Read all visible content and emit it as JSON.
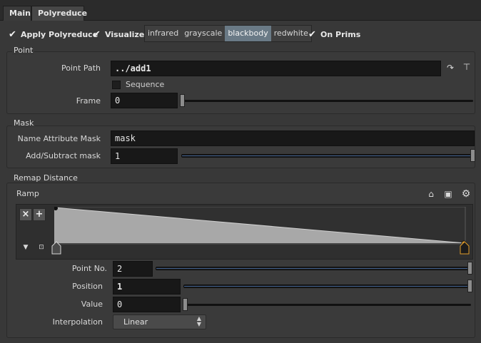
{
  "tabs": {
    "main": "Main",
    "polyreduce": "Polyreduce"
  },
  "options": {
    "apply_polyreduce": {
      "label": "Apply Polyreduce",
      "checked": true
    },
    "visualize": {
      "label": "Visualize",
      "checked": true
    },
    "on_prims": {
      "label": "On Prims",
      "checked": true
    },
    "color_schemes": [
      "infrared",
      "grayscale",
      "blackbody",
      "redwhite"
    ],
    "selected_scheme": "blackbody"
  },
  "point": {
    "title": "Point",
    "path_label": "Point Path",
    "path_value": "../add1",
    "sequence_label": "Sequence",
    "sequence_checked": false,
    "frame_label": "Frame",
    "frame_value": "0",
    "frame_level": 0.0
  },
  "mask": {
    "title": "Mask",
    "name_label": "Name Attribute Mask",
    "name_value": "mask",
    "addsub_label": "Add/Subtract mask",
    "addsub_value": "1",
    "addsub_level": 1.0
  },
  "remap": {
    "title": "Remap Distance",
    "ramp_label": "Ramp",
    "ramp": {
      "type": "linear",
      "keys": [
        {
          "position": 0,
          "value": 1
        },
        {
          "position": 1,
          "value": 0
        }
      ]
    },
    "point_no_label": "Point No.",
    "point_no_value": "2",
    "position_label": "Position",
    "position_value": "1",
    "value_label": "Value",
    "value_value": "0",
    "interp_label": "Interpolation",
    "interp_value": "Linear"
  },
  "colors": {
    "selected_segment": "#6a7a86",
    "slider_fill": "#3d5c8a",
    "background": "#383838"
  }
}
